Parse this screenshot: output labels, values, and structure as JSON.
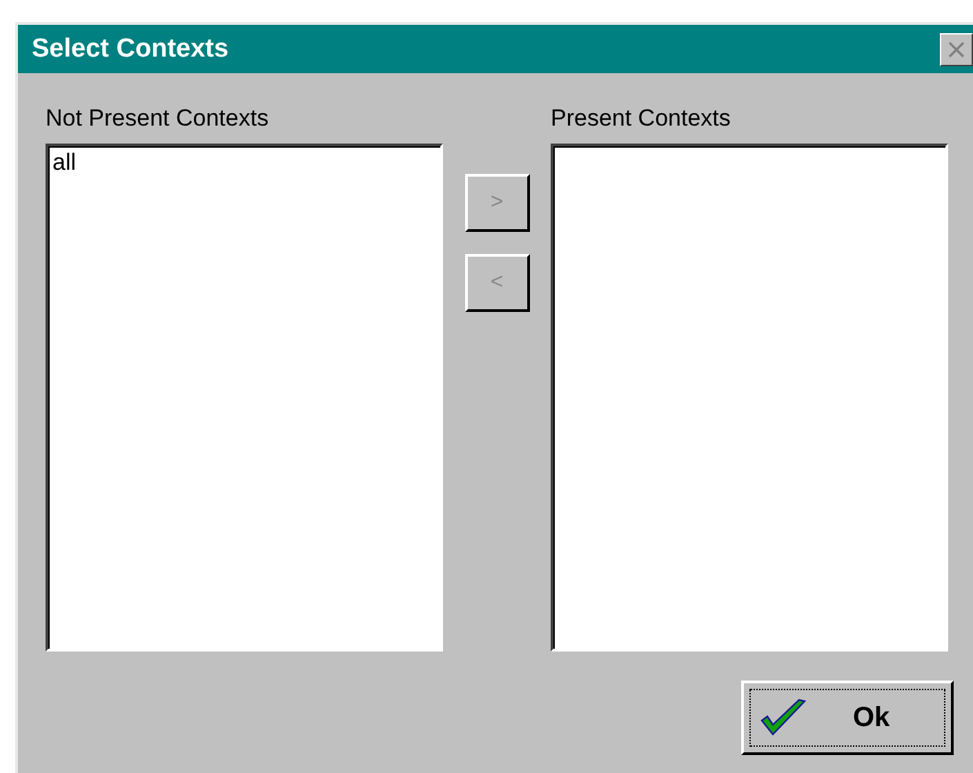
{
  "window": {
    "title": "Select Contexts"
  },
  "lists": [
    {
      "label": "Not Present Contexts",
      "items": [
        {
          "text": "all",
          "selected": false
        }
      ]
    },
    {
      "label": "Present Contexts"
    }
  ],
  "move_buttons": [
    {
      "label": ">",
      "disabled": true
    },
    {
      "label": "<",
      "disabled": true
    }
  ],
  "ok_button": {
    "label": "Ok"
  }
}
